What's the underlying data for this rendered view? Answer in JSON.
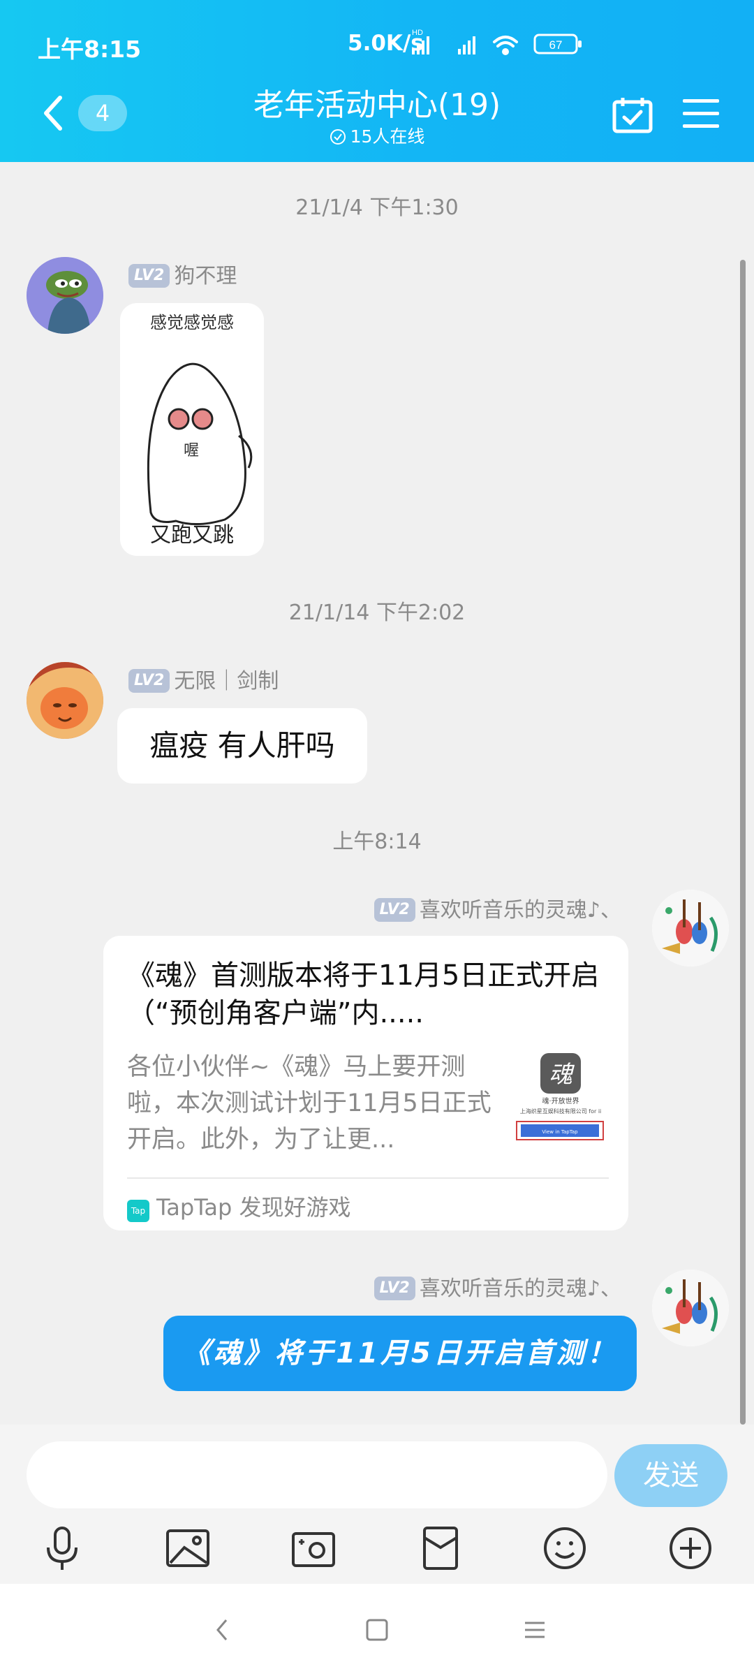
{
  "status": {
    "time": "上午8:15",
    "network": "5.0K/s",
    "battery": "67"
  },
  "header": {
    "back_count": "4",
    "title": "老年活动中心(19)",
    "online": "15人在线"
  },
  "messages": {
    "sep1": "21/1/4 下午1:30",
    "msg1": {
      "level": "LV2",
      "name": "狗不理",
      "sticker_top": "感觉感觉感",
      "sticker_bottom": "又跑又跳",
      "sticker_mid": "喔"
    },
    "sep2": "21/1/14 下午2:02",
    "msg2": {
      "level": "LV2",
      "name": "无限｜剑制",
      "text": "瘟疫 有人肝吗"
    },
    "sep3": "上午8:14",
    "msg3": {
      "level": "LV2",
      "name": "喜欢听音乐的灵魂♪、",
      "card_title": "《魂》首测版本将于11月5日正式开启（“预创角客户端”内.....",
      "card_desc": "各位小伙伴~《魂》马上要开测啦，本次测试计划于11月5日正式开启。此外，为了让更...",
      "source": "TapTap 发现好游戏",
      "thumb_logo": "魂",
      "thumb_caption": "魂·开放世界",
      "thumb_company": "上海织星互娱科技有限公司 for ii",
      "thumb_button": "View in TapTap"
    },
    "msg4": {
      "level": "LV2",
      "name": "喜欢听音乐的灵魂♪、",
      "text": "《魂》将于11月5日开启首测！"
    }
  },
  "input": {
    "value": "",
    "send_label": "发送"
  },
  "toolbar": [
    "microphone-icon",
    "image-icon",
    "camera-icon",
    "red-packet-icon",
    "emoji-icon",
    "plus-icon"
  ],
  "nav": [
    "back-icon",
    "home-icon",
    "menu-icon"
  ]
}
